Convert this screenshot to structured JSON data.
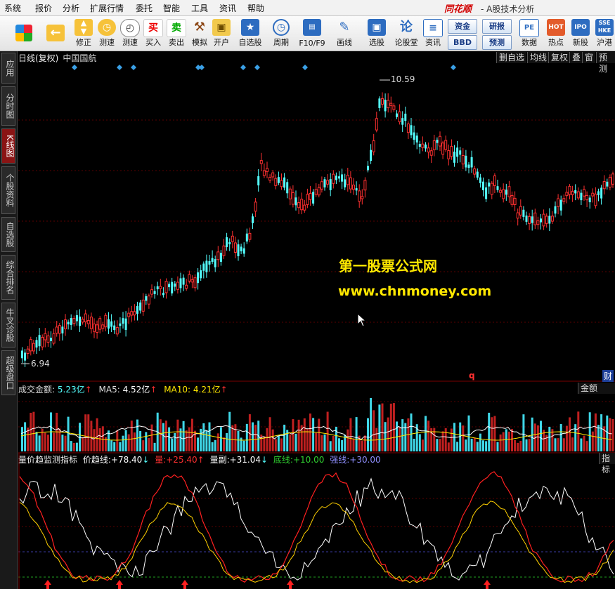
{
  "menu": {
    "items": [
      "系统",
      "报价",
      "分析",
      "扩展行情",
      "委托",
      "智能",
      "工具",
      "资讯",
      "帮助"
    ],
    "brand": "同花顺",
    "title": "- A股技术分析"
  },
  "toolbar": {
    "buttons": [
      {
        "label": "",
        "icon": "windows-grid-icon"
      },
      {
        "label": "",
        "icon": "back-arrow-icon"
      },
      {
        "label": "修正",
        "icon": "updown-arrows-icon"
      },
      {
        "label": "测速",
        "icon": "speed-clock-icon"
      },
      {
        "label": "买入",
        "icon": "buy-icon"
      },
      {
        "label": "卖出",
        "icon": "sell-icon"
      },
      {
        "label": "模拟",
        "icon": "hammer-icon"
      },
      {
        "label": "开户",
        "icon": "lock-icon"
      },
      {
        "label": "自选股",
        "icon": "star-icon"
      },
      {
        "label": "周期",
        "icon": "clock-icon"
      },
      {
        "label": "F10/F9",
        "icon": "f10-icon"
      },
      {
        "label": "画线",
        "icon": "pencil-icon"
      },
      {
        "label": "选股",
        "icon": "select-stock-icon"
      },
      {
        "label": "论股堂",
        "icon": "forum-icon"
      },
      {
        "label": "资讯",
        "icon": "news-icon"
      },
      {
        "label": "数据",
        "icon": "pe-data-icon"
      },
      {
        "label": "热点",
        "icon": "hot-icon"
      },
      {
        "label": "新股",
        "icon": "ipo-icon"
      },
      {
        "label": "沪港",
        "icon": "sse-hk-icon"
      }
    ],
    "pills": [
      "资金",
      "研报",
      "BBD",
      "预测"
    ],
    "buy_glyph": "买",
    "sell_glyph": "卖"
  },
  "left_tabs": [
    "应用",
    "分时图",
    "K线图",
    "个股资料",
    "自选股",
    "综合排名",
    "牛叉诊股",
    "超级盘口"
  ],
  "kline": {
    "header": "日线(复权)",
    "stock": "中国国航",
    "right_buttons": [
      "删自选",
      "均线",
      "复权",
      "叠",
      "窗",
      "预测"
    ],
    "high_label": "10.59",
    "low_label": "6.94",
    "q_mark": "q",
    "cai_mark": "财"
  },
  "watermark": {
    "line1": "第一股票公式网",
    "line2": "www.chnmoney.com"
  },
  "volume": {
    "label": "成交金额:",
    "value": "5.23亿",
    "ma5_label": "MA5:",
    "ma5": "4.52亿",
    "ma10_label": "MA10:",
    "ma10": "4.21亿",
    "right_btn": "金额"
  },
  "indicator": {
    "name": "量价趋监测指标",
    "items": [
      {
        "label": "价趋线:",
        "value": "+78.40",
        "color": "#ffffff"
      },
      {
        "label": "量:",
        "value": "+25.40",
        "color": "#ff3030"
      },
      {
        "label": "量副:",
        "value": "+31.04",
        "color": "#ffffff"
      },
      {
        "label": "底线:",
        "value": "+10.00",
        "color": "#30d030"
      },
      {
        "label": "强线:",
        "value": "+30.00",
        "color": "#8f8fff"
      }
    ],
    "right_btn": "指标"
  },
  "colors": {
    "up": "#ff3030",
    "down": "#54ffff",
    "signal": "#3aa0e6",
    "yellow": "#ffe800"
  }
}
